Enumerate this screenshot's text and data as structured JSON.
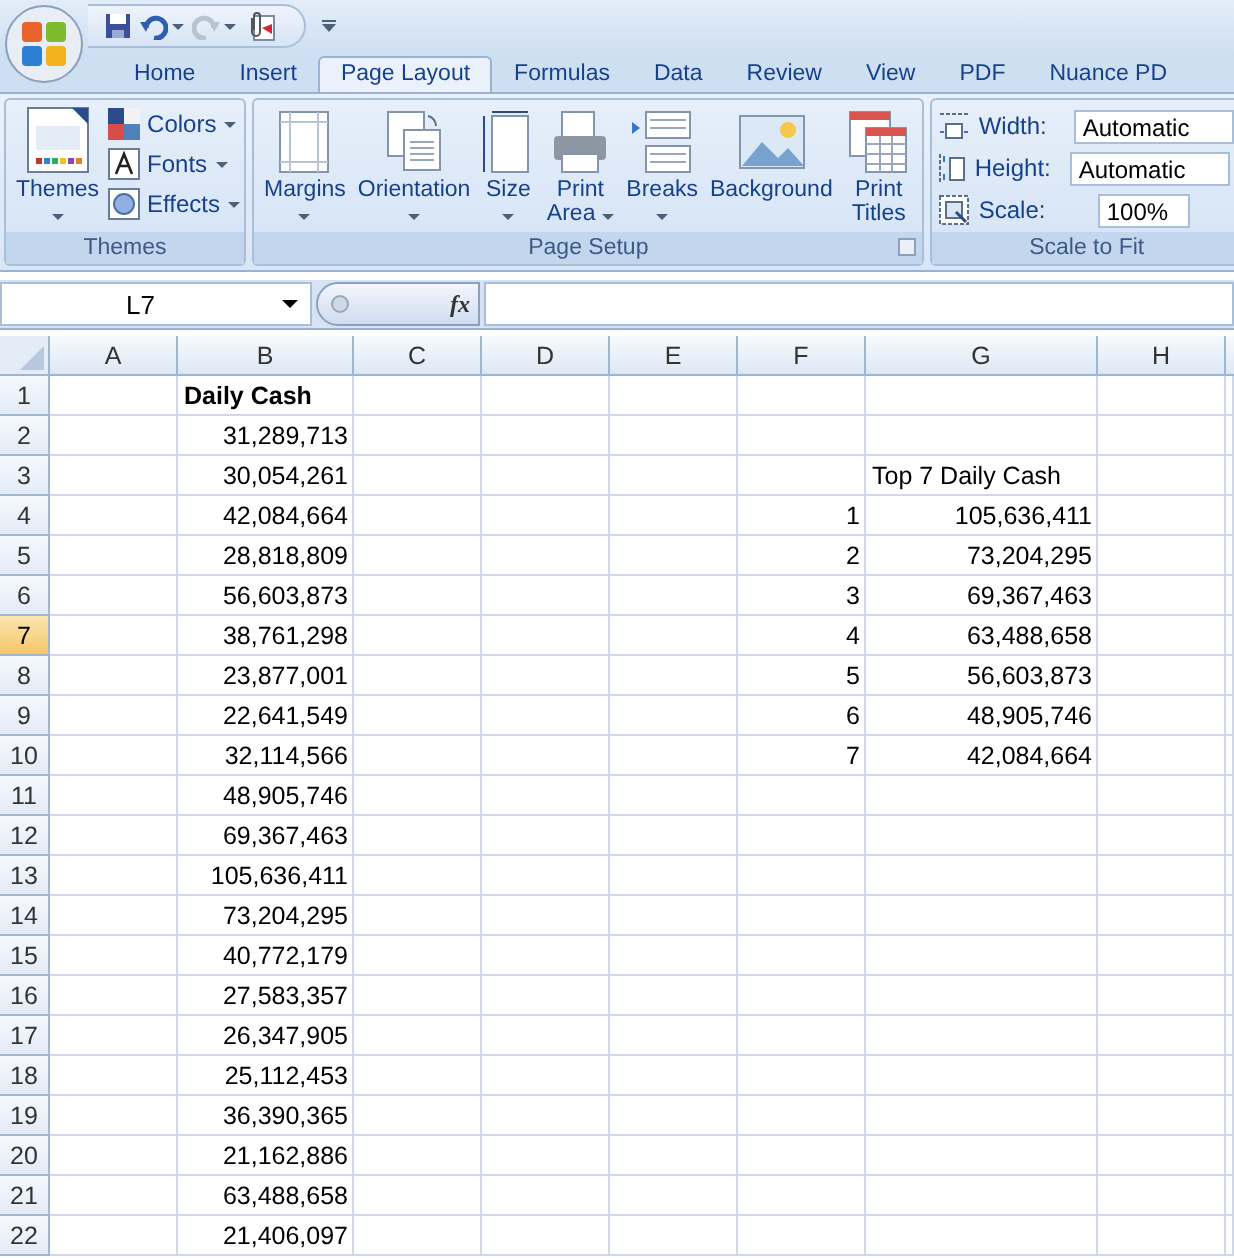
{
  "quick_access": {
    "redo_disabled": true
  },
  "tabs": [
    {
      "label": "Home",
      "selected": false
    },
    {
      "label": "Insert",
      "selected": false
    },
    {
      "label": "Page Layout",
      "selected": true
    },
    {
      "label": "Formulas",
      "selected": false
    },
    {
      "label": "Data",
      "selected": false
    },
    {
      "label": "Review",
      "selected": false
    },
    {
      "label": "View",
      "selected": false
    },
    {
      "label": "PDF",
      "selected": false
    },
    {
      "label": "Nuance PD",
      "selected": false
    }
  ],
  "groups": [
    {
      "title": "Themes",
      "launcher": false,
      "items": [
        {
          "kind": "large",
          "label": "Themes",
          "dropdown": true
        },
        {
          "kind": "small",
          "label": "Colors",
          "dropdown": true
        },
        {
          "kind": "small",
          "label": "Fonts",
          "dropdown": true
        },
        {
          "kind": "small",
          "label": "Effects",
          "dropdown": true
        }
      ]
    },
    {
      "title": "Page Setup",
      "launcher": true,
      "items": [
        {
          "kind": "large",
          "label": "Margins",
          "dropdown": true
        },
        {
          "kind": "large",
          "label": "Orientation",
          "dropdown": true
        },
        {
          "kind": "large",
          "label": "Size",
          "dropdown": true
        },
        {
          "kind": "tall",
          "label": "Print Area",
          "dropdown": true
        },
        {
          "kind": "large",
          "label": "Breaks",
          "dropdown": true
        },
        {
          "kind": "large",
          "label": "Background",
          "dropdown": false
        },
        {
          "kind": "tall",
          "label": "Print Titles",
          "dropdown": false
        }
      ]
    },
    {
      "title": "Scale to Fit",
      "launcher": false,
      "items": [
        {
          "kind": "field",
          "label": "Width:",
          "value": "Automatic"
        },
        {
          "kind": "field",
          "label": "Height:",
          "value": "Automatic"
        },
        {
          "kind": "spin",
          "label": "Scale:",
          "value": "100%"
        }
      ]
    }
  ],
  "name_box": "L7",
  "formula_button": "fx",
  "columns": [
    "A",
    "B",
    "C",
    "D",
    "E",
    "F",
    "G",
    "H"
  ],
  "rows": [
    {
      "header": "1",
      "selected": false,
      "kind": "heading",
      "b": "Daily Cash"
    },
    {
      "header": "2",
      "selected": false,
      "kind": "data",
      "b": "31,289,713"
    },
    {
      "header": "3",
      "selected": false,
      "kind": "label",
      "b": "30,054,261",
      "g": "Top 7 Daily Cash"
    },
    {
      "header": "4",
      "selected": false,
      "kind": "data",
      "b": "42,084,664",
      "f": "1",
      "g": "105,636,411"
    },
    {
      "header": "5",
      "selected": false,
      "kind": "data",
      "b": "28,818,809",
      "f": "2",
      "g": "73,204,295"
    },
    {
      "header": "6",
      "selected": false,
      "kind": "data",
      "b": "56,603,873",
      "f": "3",
      "g": "69,367,463"
    },
    {
      "header": "7",
      "selected": true,
      "kind": "data",
      "b": "38,761,298",
      "f": "4",
      "g": "63,488,658"
    },
    {
      "header": "8",
      "selected": false,
      "kind": "data",
      "b": "23,877,001",
      "f": "5",
      "g": "56,603,873"
    },
    {
      "header": "9",
      "selected": false,
      "kind": "data",
      "b": "22,641,549",
      "f": "6",
      "g": "48,905,746"
    },
    {
      "header": "10",
      "selected": false,
      "kind": "data",
      "b": "32,114,566",
      "f": "7",
      "g": "42,084,664"
    },
    {
      "header": "11",
      "selected": false,
      "kind": "data",
      "b": "48,905,746"
    },
    {
      "header": "12",
      "selected": false,
      "kind": "data",
      "b": "69,367,463"
    },
    {
      "header": "13",
      "selected": false,
      "kind": "data",
      "b": "105,636,411"
    },
    {
      "header": "14",
      "selected": false,
      "kind": "data",
      "b": "73,204,295"
    },
    {
      "header": "15",
      "selected": false,
      "kind": "data",
      "b": "40,772,179"
    },
    {
      "header": "16",
      "selected": false,
      "kind": "data",
      "b": "27,583,357"
    },
    {
      "header": "17",
      "selected": false,
      "kind": "data",
      "b": "26,347,905"
    },
    {
      "header": "18",
      "selected": false,
      "kind": "data",
      "b": "25,112,453"
    },
    {
      "header": "19",
      "selected": false,
      "kind": "data",
      "b": "36,390,365"
    },
    {
      "header": "20",
      "selected": false,
      "kind": "data",
      "b": "21,162,886"
    },
    {
      "header": "21",
      "selected": false,
      "kind": "data",
      "b": "63,488,658"
    },
    {
      "header": "22",
      "selected": false,
      "kind": "data",
      "b": "21,406,097"
    }
  ]
}
